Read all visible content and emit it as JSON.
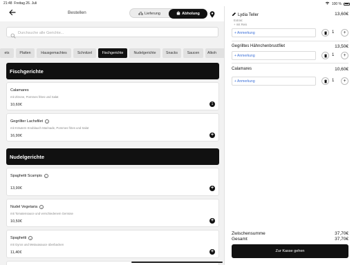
{
  "status_bar": {
    "time": "21:48",
    "date": "Freitag 26. Juli",
    "battery": "100 %"
  },
  "header": {
    "title": "Bestellen",
    "delivery_label": "Lieferung",
    "pickup_label": "Abholung"
  },
  "search": {
    "placeholder": "Durchsuche alle Gerichte..."
  },
  "tabs": [
    {
      "label": "ets"
    },
    {
      "label": "Platten"
    },
    {
      "label": "Hausgemachtes"
    },
    {
      "label": "Schnitzel"
    },
    {
      "label": "Fischgerichte"
    },
    {
      "label": "Nudelgerichte"
    },
    {
      "label": "Snacks"
    },
    {
      "label": "Saucen"
    },
    {
      "label": "Alkoh"
    }
  ],
  "sections": [
    {
      "title": "Fischgerichte",
      "items": [
        {
          "name": "Calamares",
          "desc": "mit Zitrone, Pommes frites und Salat",
          "price": "10,60€",
          "qty": "1"
        },
        {
          "name": "Gegrillter Lachsfilet",
          "desc": "mit Kräutern Knoblauch Marinade, Pommes frites und Salat",
          "price": "16,90€"
        }
      ]
    },
    {
      "title": "Nudelgerichte",
      "items": [
        {
          "name": "Spaghetti Scampis",
          "desc": "",
          "price": "13,90€"
        },
        {
          "name": "Nudel Vegetaria",
          "desc": "mit Tomatensauce und verschiedenem Gemüse",
          "price": "10,50€"
        },
        {
          "name": "Spaghetti",
          "desc": "mit Gyros und Metaxasauce überbacken",
          "price": "11,40€"
        }
      ]
    }
  ],
  "cart": {
    "items": [
      {
        "name": "Lydia Teller",
        "price": "13,60€",
        "extras_title": "Extras:",
        "extras": "+ mit Reis",
        "note_label": "+ Anmerkung",
        "qty": "1"
      },
      {
        "name": "Gegrilltes Hähnchenbrustfilet",
        "price": "13,50€",
        "note_label": "+ Anmerkung",
        "qty": "1"
      },
      {
        "name": "Calamares",
        "price": "10,60€",
        "note_label": "+ Anmerkung",
        "qty": "1"
      }
    ],
    "subtotal_label": "Zwischensumme",
    "subtotal": "37,70€",
    "total_label": "Gesamt",
    "total": "37,70€",
    "checkout_label": "Zur Kasse gehen"
  }
}
